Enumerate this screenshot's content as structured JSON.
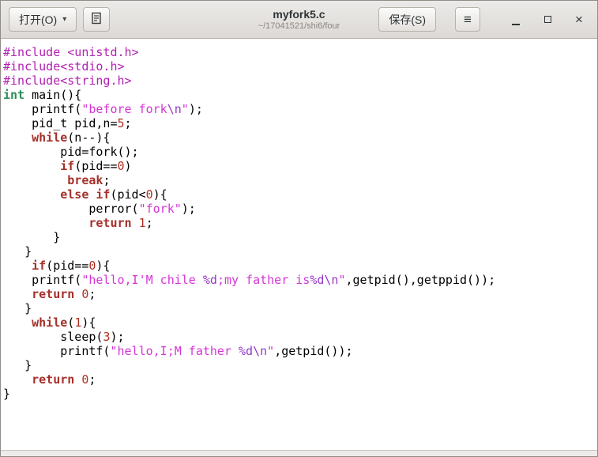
{
  "titlebar": {
    "open_label": "打开(O)",
    "title": "myfork5.c",
    "subtitle": "~/17041521/shi6/four",
    "save_label": "保存(S)"
  },
  "icons": {
    "chevron_down": "▾",
    "hamburger": "≡",
    "close": "×"
  },
  "colors": {
    "preprocessor": "#b220b2",
    "keyword": "#a5302a",
    "type": "#2e8b57",
    "string": "#d535d5",
    "escape": "#9437c8",
    "number": "#b03020",
    "plain": "#000000"
  },
  "code": {
    "language": "C",
    "lines": [
      [
        [
          "pp",
          "#include <unistd.h>"
        ]
      ],
      [
        [
          "pp",
          "#include<stdio.h>"
        ]
      ],
      [
        [
          "pp",
          "#include<string.h>"
        ]
      ],
      [
        [
          "ty",
          "int"
        ],
        [
          "pl",
          " main(){"
        ]
      ],
      [
        [
          "pl",
          "    printf("
        ],
        [
          "str",
          "\"before fork"
        ],
        [
          "esc",
          "\\n"
        ],
        [
          "str",
          "\""
        ],
        [
          "pl",
          ");"
        ]
      ],
      [
        [
          "pl",
          "    pid_t pid,n="
        ],
        [
          "num",
          "5"
        ],
        [
          "pl",
          ";"
        ]
      ],
      [
        [
          "pl",
          "    "
        ],
        [
          "kw",
          "while"
        ],
        [
          "pl",
          "(n--){"
        ]
      ],
      [
        [
          "pl",
          "        pid=fork();"
        ]
      ],
      [
        [
          "pl",
          "        "
        ],
        [
          "kw",
          "if"
        ],
        [
          "pl",
          "(pid=="
        ],
        [
          "num",
          "0"
        ],
        [
          "pl",
          ")"
        ]
      ],
      [
        [
          "pl",
          "         "
        ],
        [
          "kw",
          "break"
        ],
        [
          "pl",
          ";"
        ]
      ],
      [
        [
          "pl",
          "        "
        ],
        [
          "kw",
          "else"
        ],
        [
          "pl",
          " "
        ],
        [
          "kw",
          "if"
        ],
        [
          "pl",
          "(pid<"
        ],
        [
          "num",
          "0"
        ],
        [
          "pl",
          "){"
        ]
      ],
      [
        [
          "pl",
          "            perror("
        ],
        [
          "str",
          "\"fork\""
        ],
        [
          "pl",
          ");"
        ]
      ],
      [
        [
          "pl",
          "            "
        ],
        [
          "kw",
          "return"
        ],
        [
          "pl",
          " "
        ],
        [
          "num",
          "1"
        ],
        [
          "pl",
          ";"
        ]
      ],
      [
        [
          "pl",
          "       }"
        ]
      ],
      [
        [
          "pl",
          "   }"
        ]
      ],
      [
        [
          "pl",
          "    "
        ],
        [
          "kw",
          "if"
        ],
        [
          "pl",
          "(pid=="
        ],
        [
          "num",
          "0"
        ],
        [
          "pl",
          "){"
        ]
      ],
      [
        [
          "pl",
          "    printf("
        ],
        [
          "str",
          "\"hello,I'M chile "
        ],
        [
          "esc",
          "%d"
        ],
        [
          "str",
          ";my father is"
        ],
        [
          "esc",
          "%d\\n"
        ],
        [
          "str",
          "\""
        ],
        [
          "pl",
          ",getpid(),getppid());"
        ]
      ],
      [
        [
          "pl",
          "    "
        ],
        [
          "kw",
          "return"
        ],
        [
          "pl",
          " "
        ],
        [
          "num",
          "0"
        ],
        [
          "pl",
          ";"
        ]
      ],
      [
        [
          "pl",
          "   }"
        ]
      ],
      [
        [
          "pl",
          "    "
        ],
        [
          "kw",
          "while"
        ],
        [
          "pl",
          "("
        ],
        [
          "num",
          "1"
        ],
        [
          "pl",
          "){"
        ]
      ],
      [
        [
          "pl",
          "        sleep("
        ],
        [
          "num",
          "3"
        ],
        [
          "pl",
          ");"
        ]
      ],
      [
        [
          "pl",
          "        printf("
        ],
        [
          "str",
          "\"hello,I;M father "
        ],
        [
          "esc",
          "%d\\n"
        ],
        [
          "str",
          "\""
        ],
        [
          "pl",
          ",getpid());"
        ]
      ],
      [
        [
          "pl",
          "   }"
        ]
      ],
      [
        [
          "pl",
          "    "
        ],
        [
          "kw",
          "return"
        ],
        [
          "pl",
          " "
        ],
        [
          "num",
          "0"
        ],
        [
          "pl",
          ";"
        ]
      ],
      [
        [
          "pl",
          "}"
        ]
      ]
    ]
  }
}
